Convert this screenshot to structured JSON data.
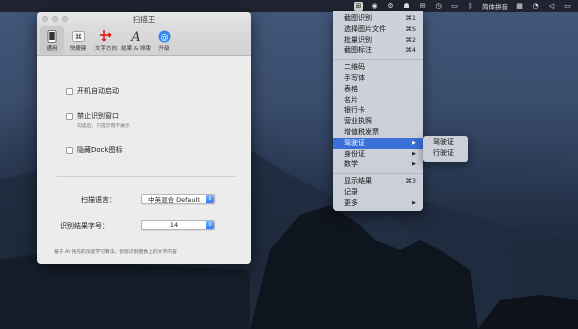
{
  "menubar": {
    "items": [
      {
        "icon": "scanner-app-icon",
        "glyph": "⊞",
        "active": true
      },
      {
        "icon": "status-circle-icon",
        "glyph": "◉"
      },
      {
        "icon": "gear-icon",
        "glyph": "⚙"
      },
      {
        "icon": "qq-penguin-icon",
        "glyph": "☗"
      },
      {
        "icon": "wechat-icon",
        "glyph": "✉"
      },
      {
        "icon": "clock-icon",
        "glyph": "◷"
      },
      {
        "icon": "display-icon",
        "glyph": "▭"
      },
      {
        "icon": "bluetooth-icon",
        "glyph": "ᛒ"
      }
    ],
    "input_method": "简体拼音",
    "trailing_icons": [
      {
        "icon": "grid-icon",
        "glyph": "▦"
      },
      {
        "icon": "wifi-icon",
        "glyph": "◔"
      },
      {
        "icon": "volume-icon",
        "glyph": "◁"
      },
      {
        "icon": "battery-icon",
        "glyph": "▭"
      }
    ]
  },
  "window": {
    "title": "扫描王",
    "toolbar": [
      {
        "label": "通用",
        "icon": "phone-icon",
        "selected": true
      },
      {
        "label": "快捷键",
        "icon": "command-key-icon"
      },
      {
        "label": "文字方向",
        "icon": "text-direction-icon"
      },
      {
        "label": "结果 & 排版",
        "icon": "font-a-icon"
      },
      {
        "label": "升级",
        "icon": "at-sign-icon"
      }
    ],
    "general": {
      "launch_at_login": "开机自动启动",
      "disable_recognition_window": "禁止识别窗口",
      "disable_recognition_hint": "勾选后，只提示而不展示",
      "hide_dock_icon": "隐藏Dock图标",
      "scan_language_label": "扫描语言：",
      "scan_language_value": "中英混合  Default",
      "font_size_label": "识别结果字号：",
      "font_size_value": "14",
      "footer": "基于 AI 领先的深度学习算法，智能识别图像上的文字内容"
    }
  },
  "menu": {
    "group1": [
      {
        "label": "截图识别",
        "shortcut": "⌘1"
      },
      {
        "label": "选择图片文件",
        "shortcut": "⌘S"
      },
      {
        "label": "批量识别",
        "shortcut": "⌘2"
      },
      {
        "label": "截图标注",
        "shortcut": "⌘4"
      }
    ],
    "group2": [
      {
        "label": "二维码"
      },
      {
        "label": "手写体"
      },
      {
        "label": "表格"
      },
      {
        "label": "名片"
      },
      {
        "label": "银行卡"
      },
      {
        "label": "营业执照"
      },
      {
        "label": "增值税发票"
      },
      {
        "label": "驾驶证",
        "submenu": true,
        "highlighted": true
      },
      {
        "label": "身份证",
        "submenu": true
      },
      {
        "label": "数学",
        "submenu": true
      }
    ],
    "group3": [
      {
        "label": "显示结果",
        "shortcut": "⌘3"
      },
      {
        "label": "记录"
      },
      {
        "label": "更多",
        "submenu": true
      }
    ],
    "submenu_arrow": "▶"
  },
  "submenu": {
    "items": [
      "驾驶证",
      "行驶证"
    ]
  }
}
